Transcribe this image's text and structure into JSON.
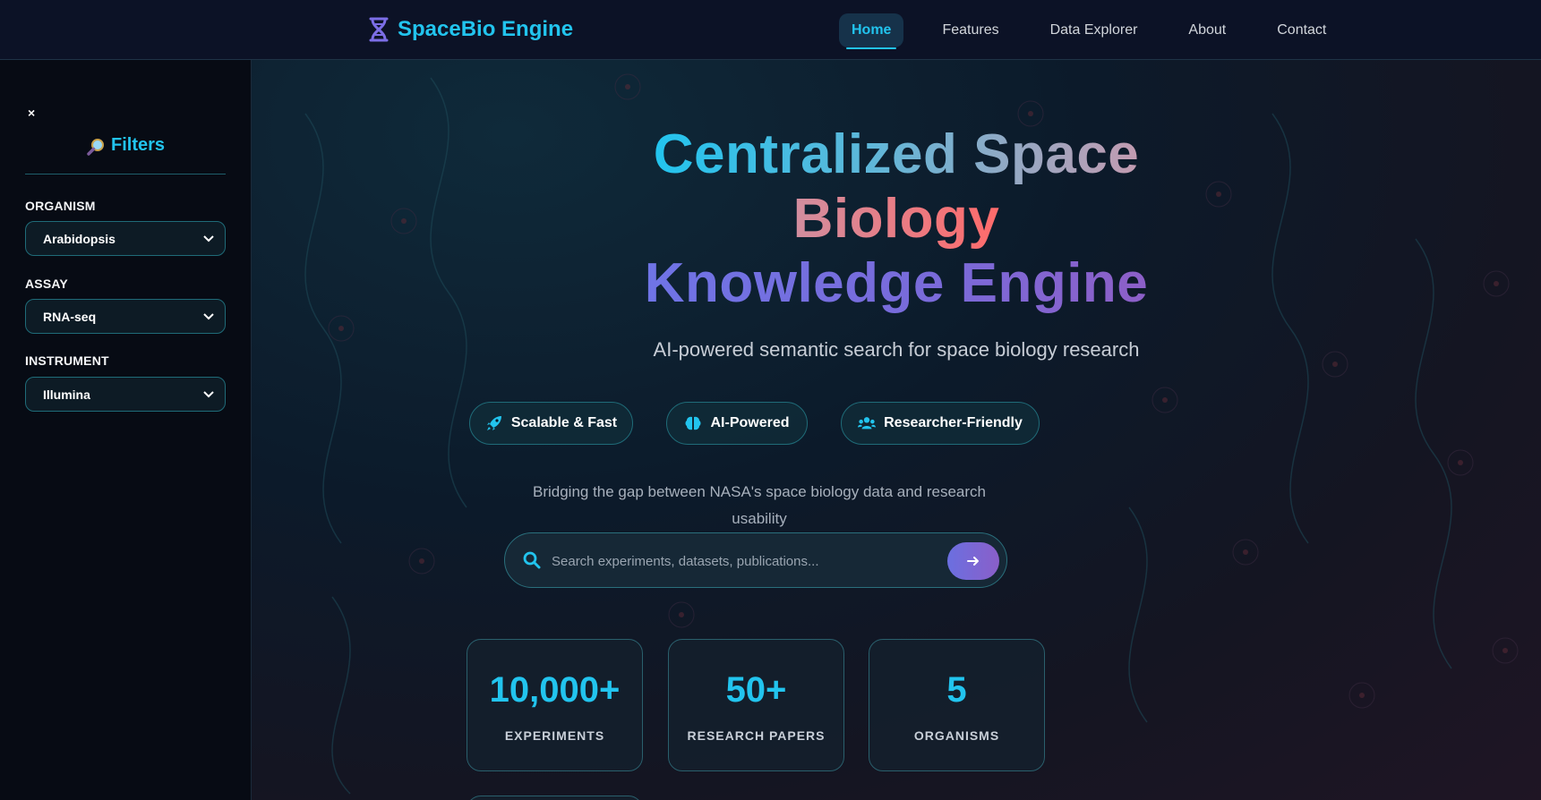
{
  "nav": {
    "brand": "SpaceBio Engine",
    "brand_icon": "dna-icon",
    "links": [
      {
        "label": "Home",
        "active": true
      },
      {
        "label": "Features",
        "active": false
      },
      {
        "label": "Data Explorer",
        "active": false
      },
      {
        "label": "About",
        "active": false
      },
      {
        "label": "Contact",
        "active": false
      }
    ]
  },
  "sidebar": {
    "close_label": "×",
    "title": "Filters",
    "title_icon": "magnifying-glass-icon",
    "filters": [
      {
        "label": "ORGANISM",
        "value": "Arabidopsis"
      },
      {
        "label": "ASSAY",
        "value": "RNA-seq"
      },
      {
        "label": "INSTRUMENT",
        "value": "Illumina"
      }
    ]
  },
  "hero": {
    "title_line1_a": "Centralized Space",
    "title_line2": "Biology",
    "title_line3": "Knowledge Engine",
    "subtitle": "AI-powered semantic search for space biology research",
    "pills": [
      {
        "label": "Scalable & Fast",
        "icon": "rocket-icon"
      },
      {
        "label": "AI-Powered",
        "icon": "brain-icon"
      },
      {
        "label": "Researcher-Friendly",
        "icon": "users-icon"
      }
    ],
    "tagline": "Bridging the gap between NASA's space biology data and research usability",
    "search": {
      "placeholder": "Search experiments, datasets, publications...",
      "value": ""
    }
  },
  "stats": [
    {
      "value": "10,000+",
      "label": "EXPERIMENTS"
    },
    {
      "value": "50+",
      "label": "RESEARCH PAPERS"
    },
    {
      "value": "5",
      "label": "ORGANISMS"
    }
  ],
  "colors": {
    "accent": "#22c4ee",
    "nav_bg": "#0c1226",
    "sidebar_bg": "#070b14",
    "button_gradient_start": "#6b6fe0",
    "button_gradient_end": "#8a5fc9"
  }
}
